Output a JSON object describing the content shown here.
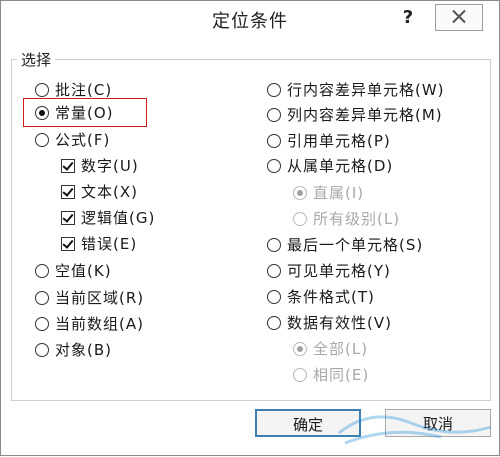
{
  "dialog": {
    "title": "定位条件",
    "help": "?",
    "group_label": "选择"
  },
  "left_options": [
    {
      "label": "批注(C)",
      "checked": false
    },
    {
      "label": "常量(O)",
      "checked": true
    },
    {
      "label": "公式(F)",
      "checked": false
    }
  ],
  "formula_checks": [
    {
      "label": "数字(U)",
      "checked": true
    },
    {
      "label": "文本(X)",
      "checked": true
    },
    {
      "label": "逻辑值(G)",
      "checked": true
    },
    {
      "label": "错误(E)",
      "checked": true
    }
  ],
  "left_options2": [
    {
      "label": "空值(K)",
      "checked": false
    },
    {
      "label": "当前区域(R)",
      "checked": false
    },
    {
      "label": "当前数组(A)",
      "checked": false
    },
    {
      "label": "对象(B)",
      "checked": false
    }
  ],
  "right_options": [
    {
      "label": "行内容差异单元格(W)",
      "checked": false
    },
    {
      "label": "列内容差异单元格(M)",
      "checked": false
    },
    {
      "label": "引用单元格(P)",
      "checked": false
    },
    {
      "label": "从属单元格(D)",
      "checked": false
    }
  ],
  "precedent_sub": [
    {
      "label": "直属(I)",
      "checked": true
    },
    {
      "label": "所有级别(L)",
      "checked": false
    }
  ],
  "right_options2": [
    {
      "label": "最后一个单元格(S)",
      "checked": false
    },
    {
      "label": "可见单元格(Y)",
      "checked": false
    },
    {
      "label": "条件格式(T)",
      "checked": false
    },
    {
      "label": "数据有效性(V)",
      "checked": false
    }
  ],
  "validation_sub": [
    {
      "label": "全部(L)",
      "checked": true
    },
    {
      "label": "相同(E)",
      "checked": false
    }
  ],
  "buttons": {
    "ok": "确定",
    "cancel": "取消"
  }
}
